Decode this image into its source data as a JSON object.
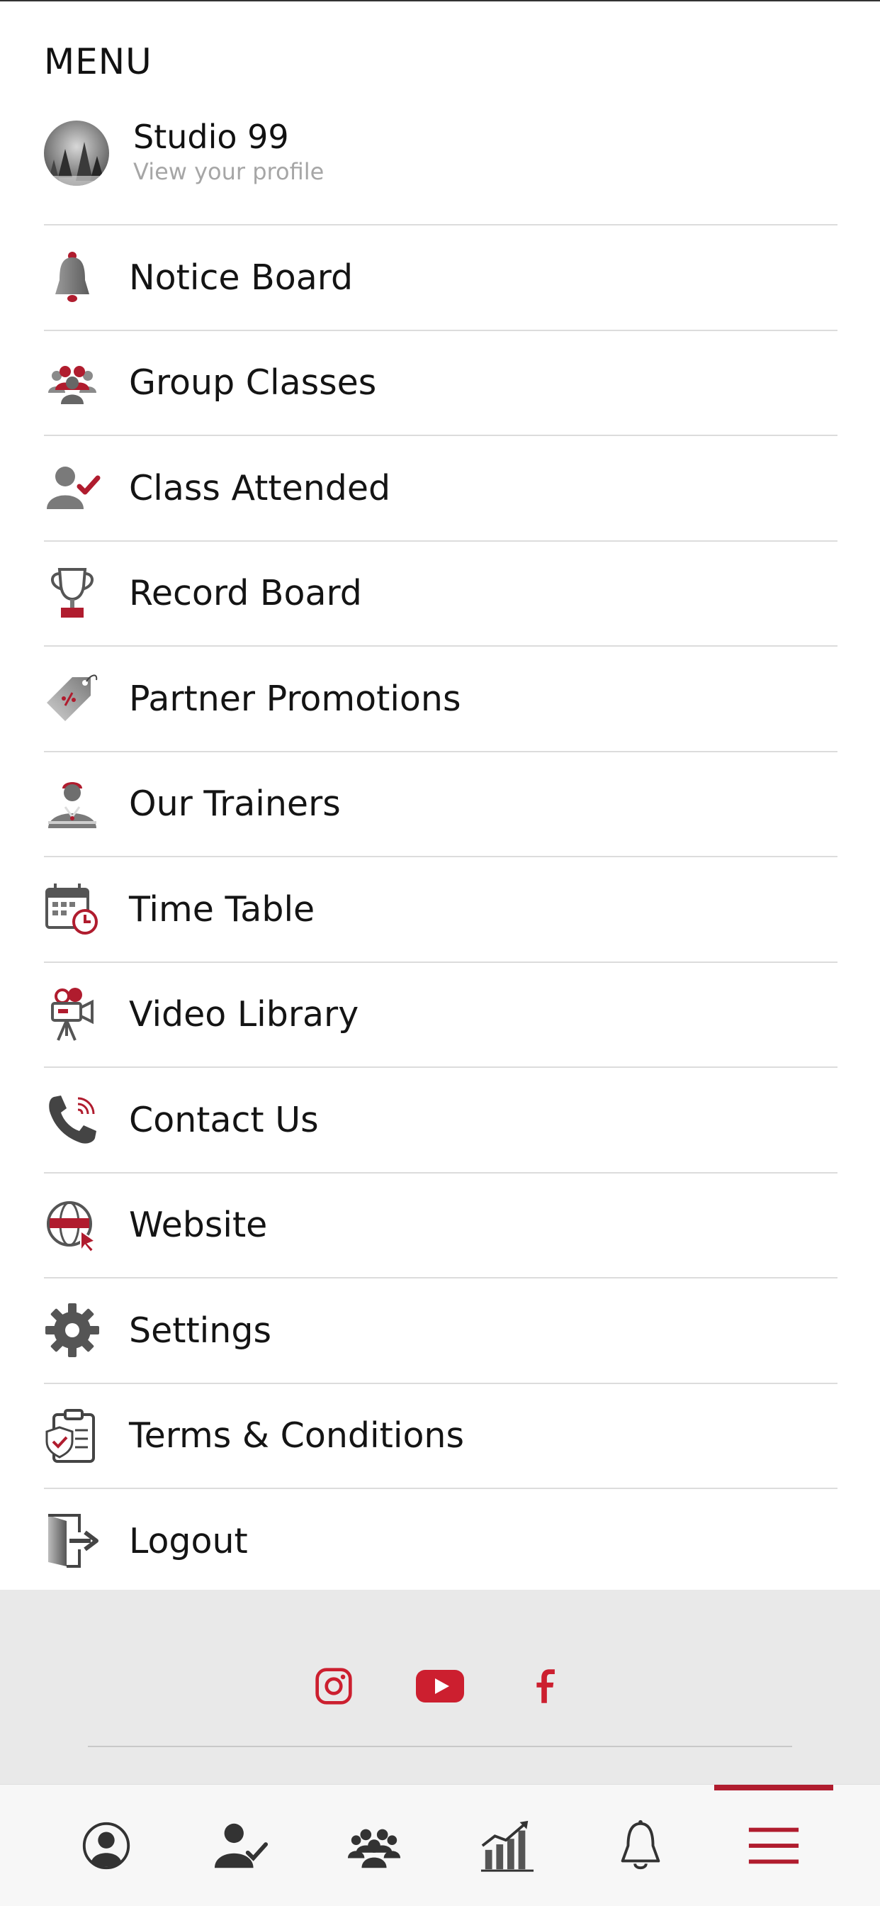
{
  "header": {
    "title": "MENU"
  },
  "profile": {
    "name": "Studio 99",
    "subtitle": "View your profile"
  },
  "menu": {
    "items": [
      {
        "label": "Notice Board",
        "icon": "bell-icon"
      },
      {
        "label": "Group Classes",
        "icon": "group-icon"
      },
      {
        "label": "Class Attended",
        "icon": "user-check-icon"
      },
      {
        "label": "Record Board",
        "icon": "trophy-icon"
      },
      {
        "label": "Partner Promotions",
        "icon": "discount-tag-icon"
      },
      {
        "label": "Our Trainers",
        "icon": "trainer-icon"
      },
      {
        "label": "Time Table",
        "icon": "calendar-clock-icon"
      },
      {
        "label": "Video Library",
        "icon": "video-camera-icon"
      },
      {
        "label": "Contact Us",
        "icon": "phone-icon"
      },
      {
        "label": "Website",
        "icon": "globe-cursor-icon"
      },
      {
        "label": "Settings",
        "icon": "gear-icon"
      },
      {
        "label": "Terms & Conditions",
        "icon": "clipboard-shield-icon"
      },
      {
        "label": "Logout",
        "icon": "logout-door-icon"
      }
    ]
  },
  "social": {
    "icons": [
      "instagram-icon",
      "youtube-icon",
      "facebook-icon"
    ]
  },
  "tabbar": {
    "tabs": [
      "profile-icon",
      "user-check-icon",
      "group-icon",
      "stats-chart-icon",
      "bell-icon",
      "hamburger-menu-icon"
    ],
    "active": "hamburger-menu-icon"
  },
  "colors": {
    "accent": "#b01c2e",
    "divider": "#dcdcdc",
    "band": "#e9e9e9",
    "icon_gray": "#6b6b6b"
  }
}
